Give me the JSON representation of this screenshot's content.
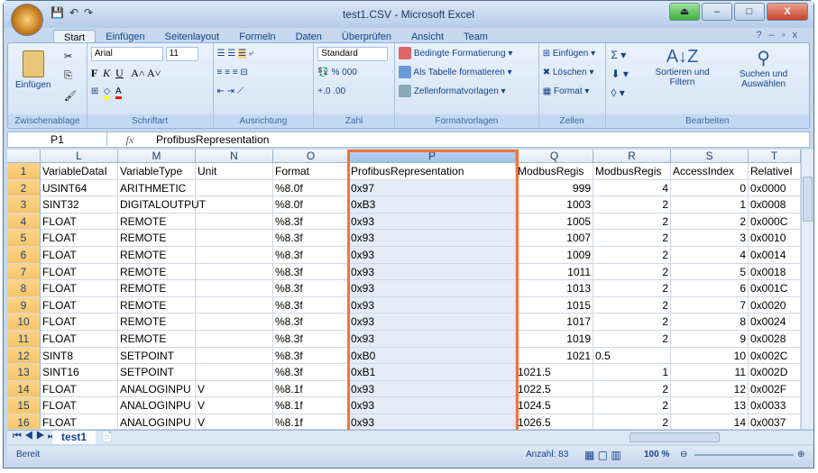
{
  "window": {
    "title": "test1.CSV - Microsoft Excel"
  },
  "ribbon": {
    "tabs": [
      "Start",
      "Einfügen",
      "Seitenlayout",
      "Formeln",
      "Daten",
      "Überprüfen",
      "Ansicht",
      "Team"
    ],
    "groups": {
      "clipboard": {
        "label": "Zwischenablage",
        "paste": "Einfügen"
      },
      "font": {
        "label": "Schriftart",
        "font": "Arial",
        "size": "11",
        "bold": "F",
        "italic": "K",
        "underline": "U"
      },
      "alignment": {
        "label": "Ausrichtung"
      },
      "number": {
        "label": "Zahl",
        "format": "Standard",
        "percent": "%",
        "thousands": "000"
      },
      "styles": {
        "label": "Formatvorlagen",
        "items": [
          "Bedingte Formatierung",
          "Als Tabelle formatieren",
          "Zellenformatvorlagen"
        ]
      },
      "cells": {
        "label": "Zellen",
        "items": [
          "Einfügen",
          "Löschen",
          "Format"
        ]
      },
      "editing": {
        "label": "Bearbeiten",
        "sort": "Sortieren und Filtern",
        "find": "Suchen und Auswählen"
      }
    }
  },
  "formula_bar": {
    "name_box": "P1",
    "fx": "fx",
    "value": "ProfibusRepresentation"
  },
  "grid": {
    "columns": [
      "L",
      "M",
      "N",
      "O",
      "P",
      "Q",
      "R",
      "S",
      "T"
    ],
    "rows": [
      [
        "1",
        "VariableDataI",
        "VariableType",
        "Unit",
        "Format",
        "ProfibusRepresentation",
        "ModbusRegis",
        "ModbusRegis",
        "AccessIndex",
        "RelativeI"
      ],
      [
        "2",
        "USINT64",
        "ARITHMETIC",
        "",
        "%8.0f",
        "0x97",
        "999",
        "4",
        "0",
        "0x0000"
      ],
      [
        "3",
        "SINT32",
        "DIGITALOUTPUT",
        "",
        "%8.0f",
        "0xB3",
        "1003",
        "2",
        "1",
        "0x0008"
      ],
      [
        "4",
        "FLOAT",
        "REMOTE",
        "",
        "%8.3f",
        "0x93",
        "1005",
        "2",
        "2",
        "0x000C"
      ],
      [
        "5",
        "FLOAT",
        "REMOTE",
        "",
        "%8.3f",
        "0x93",
        "1007",
        "2",
        "3",
        "0x0010"
      ],
      [
        "6",
        "FLOAT",
        "REMOTE",
        "",
        "%8.3f",
        "0x93",
        "1009",
        "2",
        "4",
        "0x0014"
      ],
      [
        "7",
        "FLOAT",
        "REMOTE",
        "",
        "%8.3f",
        "0x93",
        "1011",
        "2",
        "5",
        "0x0018"
      ],
      [
        "8",
        "FLOAT",
        "REMOTE",
        "",
        "%8.3f",
        "0x93",
        "1013",
        "2",
        "6",
        "0x001C"
      ],
      [
        "9",
        "FLOAT",
        "REMOTE",
        "",
        "%8.3f",
        "0x93",
        "1015",
        "2",
        "7",
        "0x0020"
      ],
      [
        "10",
        "FLOAT",
        "REMOTE",
        "",
        "%8.3f",
        "0x93",
        "1017",
        "2",
        "8",
        "0x0024"
      ],
      [
        "11",
        "FLOAT",
        "REMOTE",
        "",
        "%8.3f",
        "0x93",
        "1019",
        "2",
        "9",
        "0x0028"
      ],
      [
        "12",
        "SINT8",
        "SETPOINT",
        "",
        "%8.3f",
        "0xB0",
        "1021",
        "0.5",
        "10",
        "0x002C"
      ],
      [
        "13",
        "SINT16",
        "SETPOINT",
        "",
        "%8.3f",
        "0xB1",
        "1021.5",
        "1",
        "11",
        "0x002D"
      ],
      [
        "14",
        "FLOAT",
        "ANALOGINPU",
        "V",
        "%8.1f",
        "0x93",
        "1022.5",
        "2",
        "12",
        "0x002F"
      ],
      [
        "15",
        "FLOAT",
        "ANALOGINPU",
        "V",
        "%8.1f",
        "0x93",
        "1024.5",
        "2",
        "13",
        "0x0033"
      ],
      [
        "16",
        "FLOAT",
        "ANALOGINPU",
        "V",
        "%8.1f",
        "0x93",
        "1026.5",
        "2",
        "14",
        "0x0037"
      ]
    ],
    "num_align": [
      [
        false,
        false,
        false,
        false,
        false,
        false,
        false,
        false,
        false
      ],
      [
        false,
        false,
        false,
        false,
        false,
        true,
        true,
        true,
        false
      ],
      [
        false,
        false,
        false,
        false,
        false,
        true,
        true,
        true,
        false
      ],
      [
        false,
        false,
        false,
        false,
        false,
        true,
        true,
        true,
        false
      ],
      [
        false,
        false,
        false,
        false,
        false,
        true,
        true,
        true,
        false
      ],
      [
        false,
        false,
        false,
        false,
        false,
        true,
        true,
        true,
        false
      ],
      [
        false,
        false,
        false,
        false,
        false,
        true,
        true,
        true,
        false
      ],
      [
        false,
        false,
        false,
        false,
        false,
        true,
        true,
        true,
        false
      ],
      [
        false,
        false,
        false,
        false,
        false,
        true,
        true,
        true,
        false
      ],
      [
        false,
        false,
        false,
        false,
        false,
        true,
        true,
        true,
        false
      ],
      [
        false,
        false,
        false,
        false,
        false,
        true,
        true,
        true,
        false
      ],
      [
        false,
        false,
        false,
        false,
        false,
        true,
        false,
        true,
        false
      ],
      [
        false,
        false,
        false,
        false,
        false,
        false,
        true,
        true,
        false
      ],
      [
        false,
        false,
        false,
        false,
        false,
        false,
        true,
        true,
        false
      ],
      [
        false,
        false,
        false,
        false,
        false,
        false,
        true,
        true,
        false
      ],
      [
        false,
        false,
        false,
        false,
        false,
        false,
        true,
        true,
        false
      ]
    ]
  },
  "sheet_tabs": [
    "test1"
  ],
  "status": {
    "ready": "Bereit",
    "count": "Anzahl: 83",
    "zoom": "100 %"
  }
}
